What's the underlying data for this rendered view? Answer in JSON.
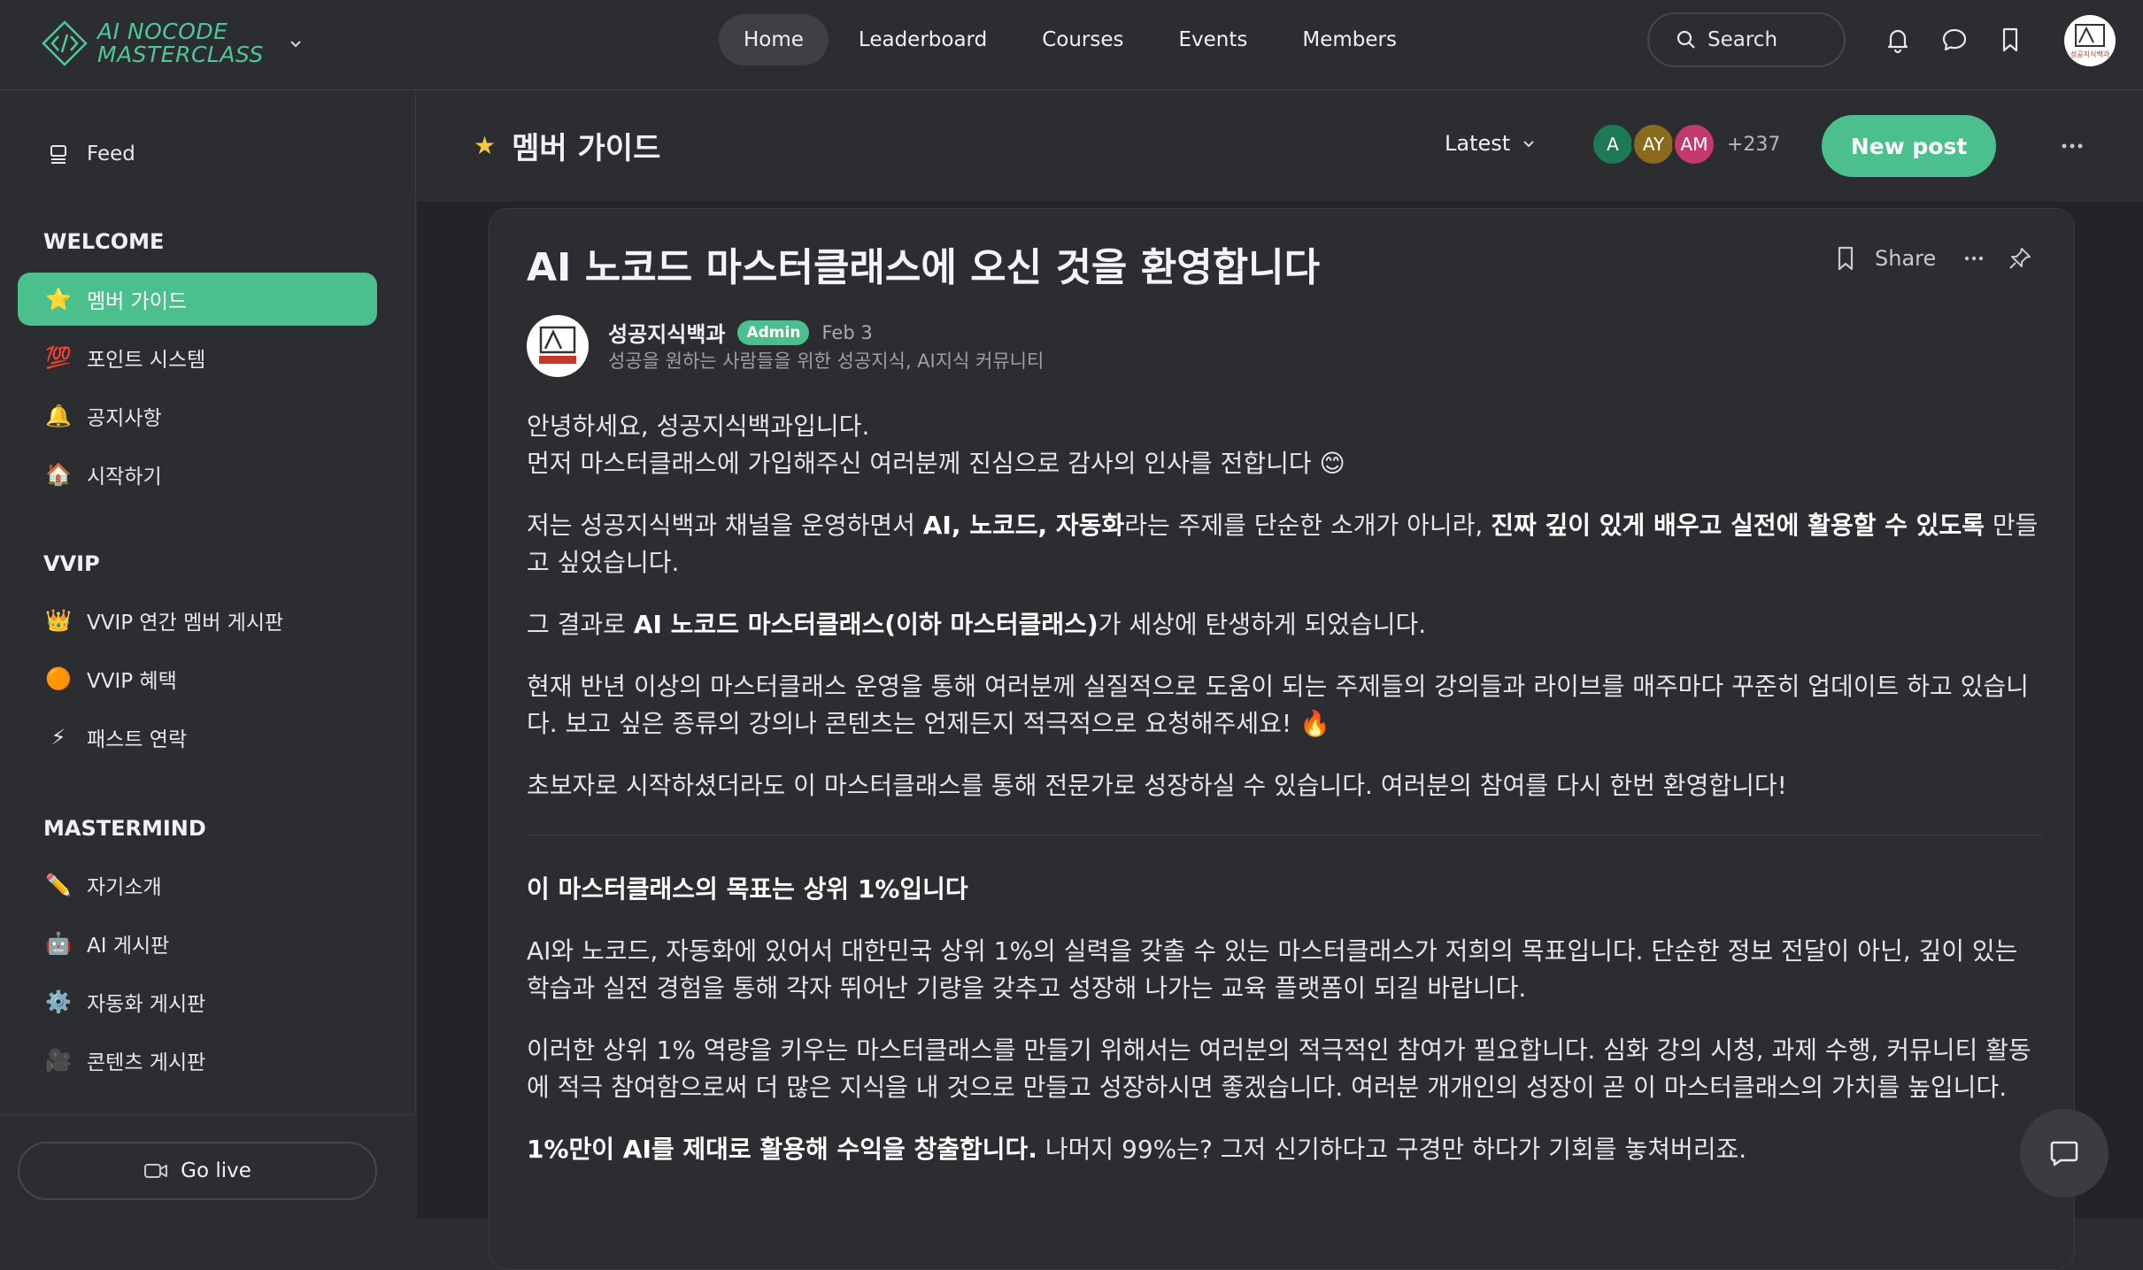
{
  "brand": {
    "line1": "AI NOCODE",
    "line2": "MASTERCLASS",
    "accent": "#4fc79a"
  },
  "nav": {
    "items": [
      "Home",
      "Leaderboard",
      "Courses",
      "Events",
      "Members"
    ],
    "active": "Home"
  },
  "search": {
    "label": "Search"
  },
  "top_avatar": {
    "text": "성공지식백과"
  },
  "sidebar": {
    "feed": {
      "icon": "feed-icon",
      "label": "Feed"
    },
    "sections": [
      {
        "title": "WELCOME",
        "items": [
          {
            "icon": "⭐",
            "label": "멤버 가이드",
            "active": true
          },
          {
            "icon": "💯",
            "label": "포인트 시스템"
          },
          {
            "icon": "🔔",
            "label": "공지사항"
          },
          {
            "icon": "🏠",
            "label": "시작하기"
          }
        ]
      },
      {
        "title": "VVIP",
        "items": [
          {
            "icon": "👑",
            "label": "VVIP 연간 멤버 게시판"
          },
          {
            "icon": "🟠",
            "label": "VVIP 혜택"
          },
          {
            "icon": "⚡",
            "label": "패스트 연락"
          }
        ]
      },
      {
        "title": "MASTERMIND",
        "items": [
          {
            "icon": "✏️",
            "label": "자기소개"
          },
          {
            "icon": "🤖",
            "label": "AI 게시판"
          },
          {
            "icon": "⚙️",
            "label": "자동화 게시판"
          },
          {
            "icon": "🎥",
            "label": "콘텐츠 게시판"
          }
        ]
      }
    ],
    "go_live": "Go live",
    "active_color": "#4bbf8e"
  },
  "header": {
    "title": "멤버 가이드",
    "sort": "Latest",
    "members": [
      {
        "initials": "A",
        "color": "#1e7a55"
      },
      {
        "initials": "AY",
        "color": "#8a6a1c"
      },
      {
        "initials": "AM",
        "color": "#c23a6b"
      }
    ],
    "member_count": "+237",
    "new_post": "New post"
  },
  "post": {
    "title": "AI 노코드 마스터클래스에 오신 것을 환영합니다",
    "share": "Share",
    "author": "성공지식백과",
    "badge": "Admin",
    "date": "Feb 3",
    "author_desc": "성공을 원하는 사람들을 위한 성공지식, AI지식 커뮤니티",
    "p1a": "안녕하세요, 성공지식백과입니다.",
    "p1b": "먼저 마스터클래스에 가입해주신 여러분께 진심으로 감사의 인사를 전합니다 😊",
    "p2a": "저는 성공지식백과 채널을 운영하면서 ",
    "p2b": "AI, 노코드, 자동화",
    "p2c": "라는 주제를 단순한 소개가 아니라, ",
    "p2d": "진짜 깊이 있게 배우고 실전에 활용할 수 있도록",
    "p2e": " 만들고 싶었습니다.",
    "p3a": "그 결과로 ",
    "p3b": "AI 노코드 마스터클래스(이하 마스터클래스)",
    "p3c": "가 세상에 탄생하게 되었습니다.",
    "p4": "현재 반년 이상의 마스터클래스 운영을 통해 여러분께 실질적으로 도움이 되는 주제들의 강의들과 라이브를 매주마다 꾸준히 업데이트 하고 있습니다. 보고 싶은 종류의 강의나 콘텐츠는 언제든지 적극적으로 요청해주세요! 🔥",
    "p5": "초보자로 시작하셨더라도 이 마스터클래스를 통해 전문가로 성장하실 수 있습니다. 여러분의 참여를 다시 한번 환영합니다!",
    "h2": "이 마스터클래스의 목표는 상위 1%입니다",
    "p6": "AI와 노코드, 자동화에 있어서 대한민국 상위 1%의 실력을 갖출 수 있는 마스터클래스가 저희의 목표입니다. 단순한 정보 전달이 아닌, 깊이 있는 학습과 실전 경험을 통해 각자 뛰어난 기량을 갖추고 성장해 나가는 교육 플랫폼이 되길 바랍니다.",
    "p7": "이러한 상위 1% 역량을 키우는 마스터클래스를 만들기 위해서는 여러분의 적극적인 참여가 필요합니다. 심화 강의 시청, 과제 수행, 커뮤니티 활동에 적극 참여함으로써 더 많은 지식을 내 것으로 만들고 성장하시면 좋겠습니다. 여러분 개개인의 성장이 곧 이 마스터클래스의 가치를 높입니다.",
    "p8a": "1%만이 AI를 제대로 활용해 수익을 창출합니다.",
    "p8b": " 나머지 99%는? 그저 신기하다고 구경만 하다가 기회를 놓쳐버리죠."
  }
}
